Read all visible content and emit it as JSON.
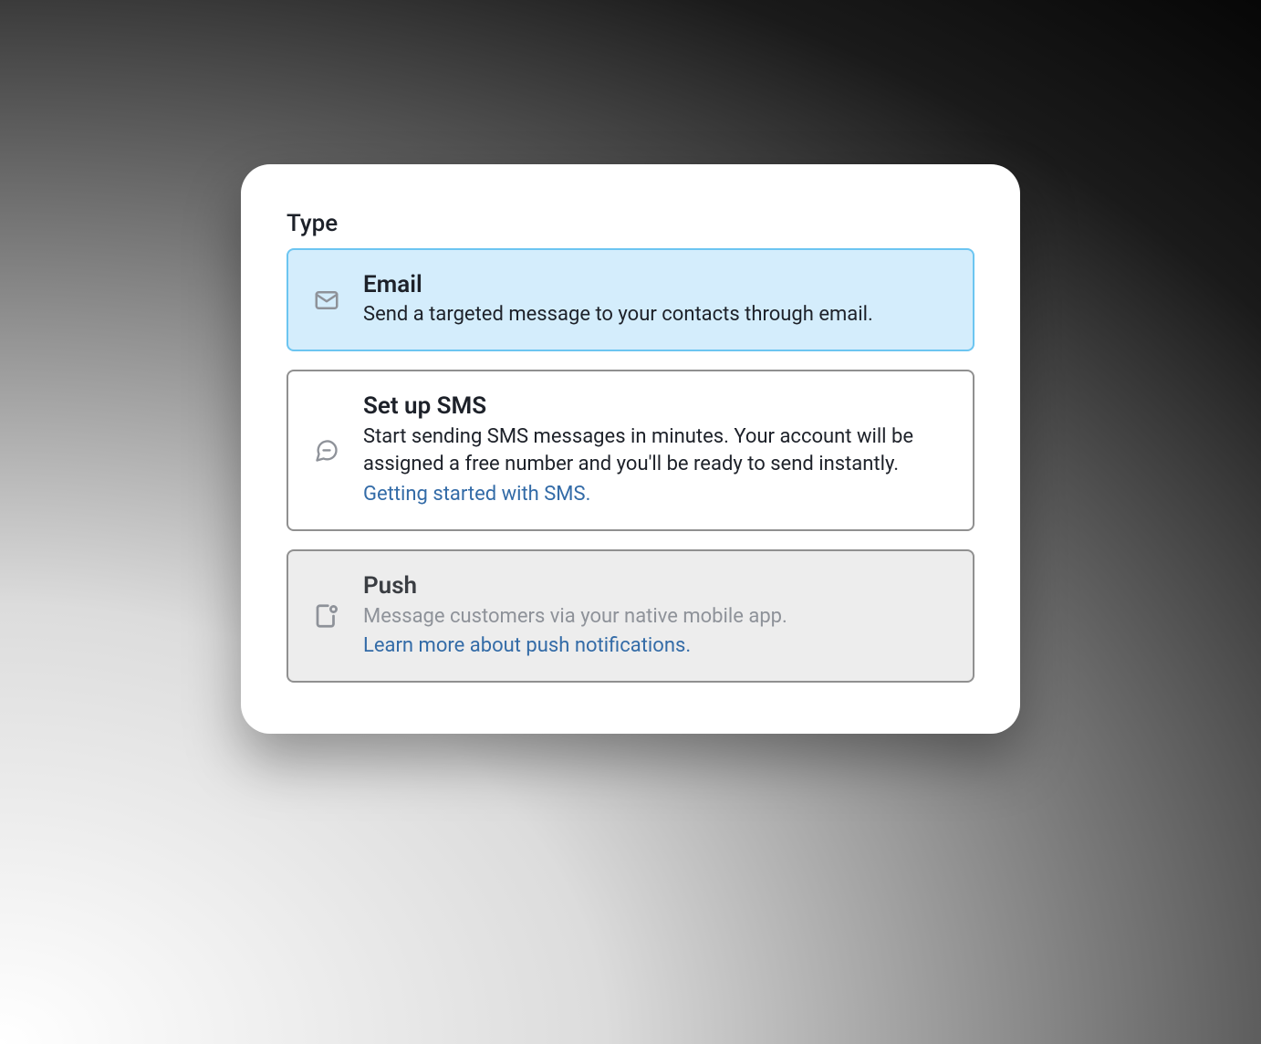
{
  "heading": "Type",
  "options": [
    {
      "icon": "mail-icon",
      "title": "Email",
      "desc": "Send a targeted message to your contacts through email.",
      "link": null,
      "selected": true,
      "disabled": false
    },
    {
      "icon": "chat-icon",
      "title": "Set up SMS",
      "desc": "Start sending SMS messages in minutes. Your account will be assigned a free number and you'll be ready to send instantly.",
      "link": "Getting started with SMS.",
      "selected": false,
      "disabled": false
    },
    {
      "icon": "push-icon",
      "title": "Push",
      "desc": "Message customers via your native mobile app.",
      "link": "Learn more about push notifications.",
      "selected": false,
      "disabled": true
    }
  ]
}
